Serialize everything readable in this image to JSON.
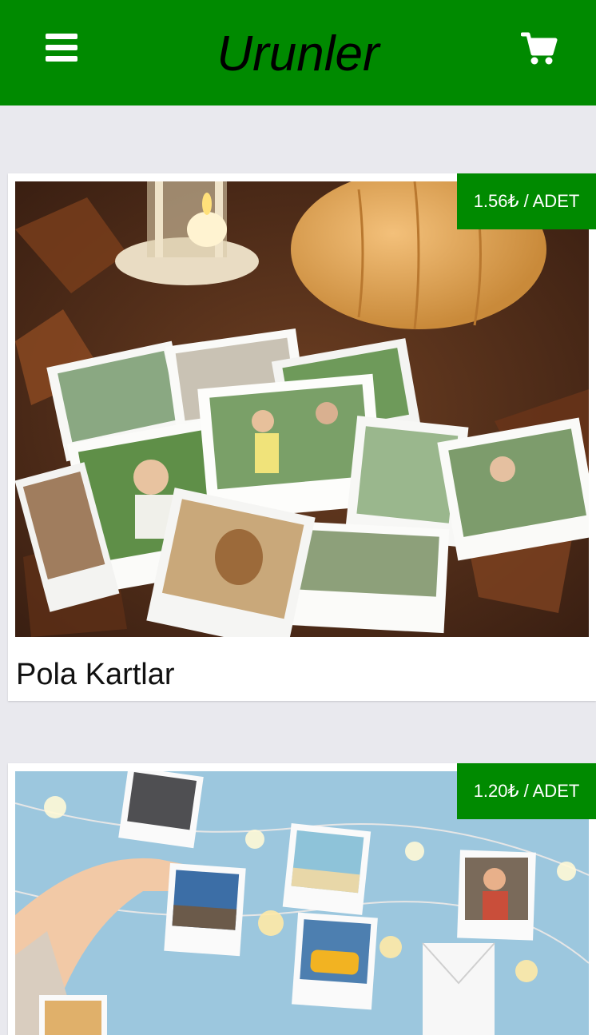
{
  "header": {
    "title": "Urunler",
    "menu_icon": "hamburger-menu-icon",
    "cart_icon": "shopping-cart-icon",
    "background_color": "#008a00"
  },
  "products": [
    {
      "title": "Pola Kartlar",
      "price": "1.56₺ / ADET",
      "image": "polaroid-photos-on-autumn-leaves-with-lantern-and-pumpkin"
    },
    {
      "title": "",
      "price": "1.20₺ / ADET",
      "image": "polaroid-photos-hanging-on-string-lights-blue-background"
    }
  ]
}
